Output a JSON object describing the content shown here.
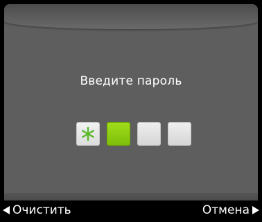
{
  "dialog": {
    "prompt": "Введите пароль"
  },
  "pin": {
    "digits_total": 4,
    "digits_entered": 1,
    "boxes": [
      {
        "state": "cursor",
        "icon": "asterisk-icon"
      },
      {
        "state": "filled"
      },
      {
        "state": "empty"
      },
      {
        "state": "empty"
      }
    ]
  },
  "softkeys": {
    "left_label": "Очистить",
    "right_label": "Отмена",
    "left_icon": "triangle-left-icon",
    "right_icon": "triangle-right-icon"
  },
  "colors": {
    "panel_bg": "#5e5e5e",
    "accent_green": "#8ccc10",
    "asterisk_green": "#5ab82a",
    "text": "#ffffff"
  }
}
